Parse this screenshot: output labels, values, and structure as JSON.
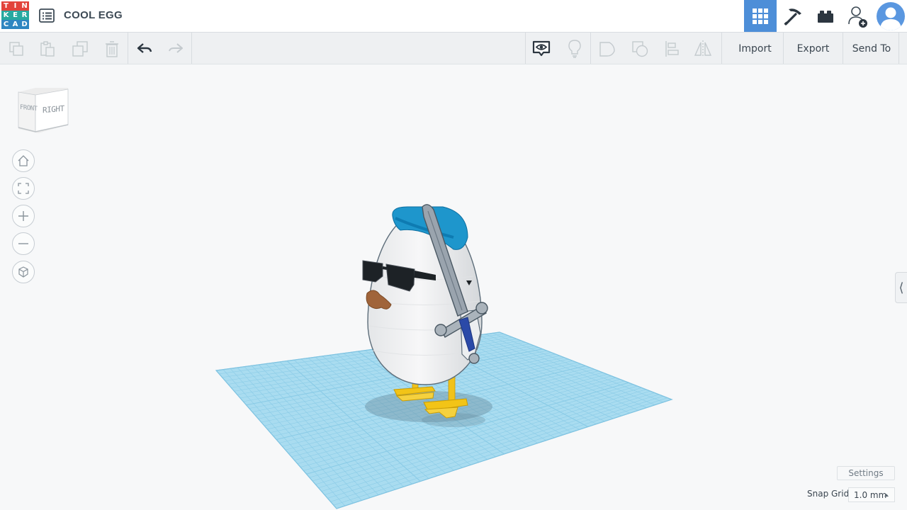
{
  "app": {
    "logo_letters": [
      "T",
      "I",
      "N",
      "K",
      "E",
      "R",
      "C",
      "A",
      "D"
    ],
    "logo_colors": [
      "#e2433b",
      "#e2433b",
      "#e2433b",
      "#27a9a0",
      "#27a9a0",
      "#27a9a0",
      "#2e86c1",
      "#2e86c1",
      "#2e86c1"
    ],
    "design_title": "COOL EGG"
  },
  "header_icons": [
    "grid-view-icon",
    "pickaxe-icon",
    "bricks-icon",
    "add-user-icon",
    "user-avatar"
  ],
  "toolbar": {
    "import_label": "Import",
    "export_label": "Export",
    "send_to_label": "Send To"
  },
  "viewcube": {
    "front_label": "FRONT",
    "right_label": "RIGHT"
  },
  "view_controls": [
    "home-view",
    "fit-all",
    "zoom-in",
    "zoom-out",
    "ortho-toggle"
  ],
  "footer": {
    "settings_label": "Settings",
    "snap_grid_label": "Snap Grid",
    "snap_grid_value": "1.0 mm"
  },
  "colors": {
    "accent": "#4d8ed8",
    "workplane": "#a8dff2",
    "beret": "#1e95c8",
    "feet": "#f2c417",
    "sword": "#9ea8b2"
  }
}
